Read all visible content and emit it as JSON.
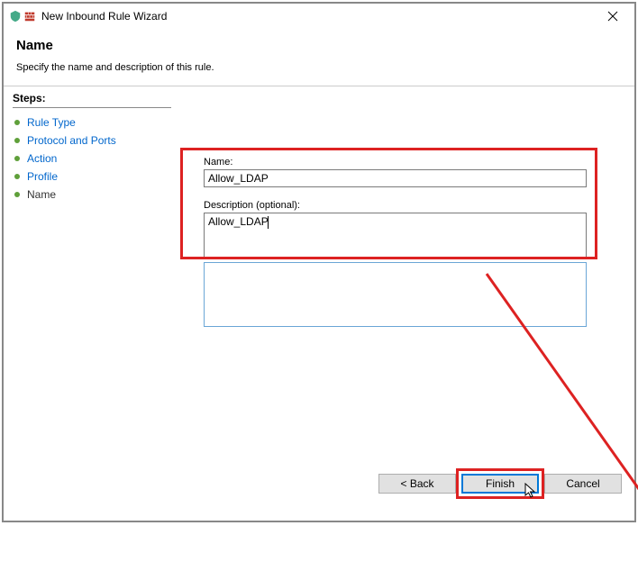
{
  "window": {
    "title": "New Inbound Rule Wizard"
  },
  "header": {
    "title": "Name",
    "description": "Specify the name and description of this rule."
  },
  "steps": {
    "label": "Steps:",
    "items": [
      {
        "label": "Rule Type",
        "current": false
      },
      {
        "label": "Protocol and Ports",
        "current": false
      },
      {
        "label": "Action",
        "current": false
      },
      {
        "label": "Profile",
        "current": false
      },
      {
        "label": "Name",
        "current": true
      }
    ]
  },
  "form": {
    "name_label": "Name:",
    "name_value": "Allow_LDAP",
    "desc_label": "Description (optional):",
    "desc_value": "Allow_LDAP"
  },
  "buttons": {
    "back": "< Back",
    "finish": "Finish",
    "cancel": "Cancel"
  }
}
